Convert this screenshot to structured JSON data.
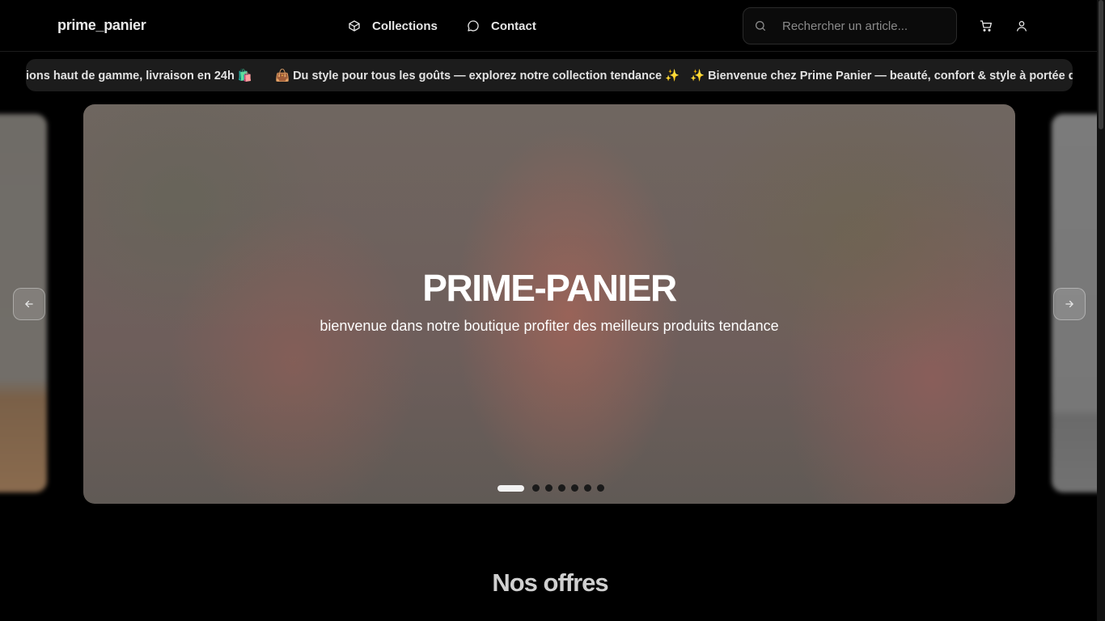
{
  "header": {
    "logo": "prime_panier",
    "nav": [
      {
        "label": "Collections",
        "icon": "box-icon"
      },
      {
        "label": "Contact",
        "icon": "chat-icon"
      }
    ],
    "search": {
      "placeholder": "Rechercher un article...",
      "value": ""
    },
    "icons": [
      "cart-icon",
      "user-icon"
    ]
  },
  "ticker": {
    "items": [
      "ions haut de gamme, livraison en 24h 🛍️",
      "👜 Du style pour tous les goûts — explorez notre collection tendance ✨",
      "✨ Bienvenue chez Prime Panier — beauté, confort & style à portée de"
    ]
  },
  "hero": {
    "title": "PRIME-PANIER",
    "subtitle": "bienvenue dans notre boutique profiter des meilleurs produits tendance",
    "slide_count": 7,
    "active_slide": 1
  },
  "section": {
    "title": "Nos offres"
  },
  "colors": {
    "background": "#000000",
    "ticker_bg": "#1c1c1c",
    "text": "#ffffff"
  }
}
